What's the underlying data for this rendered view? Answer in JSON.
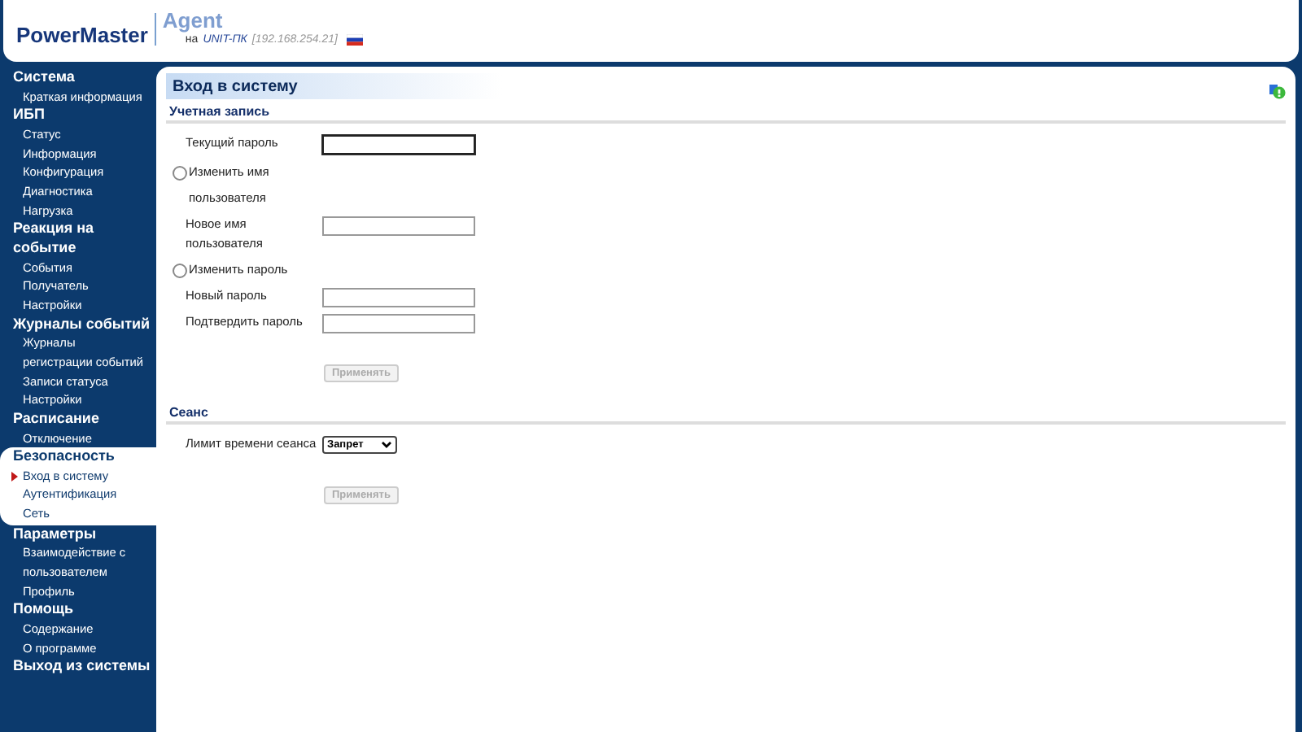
{
  "header": {
    "product": "PowerMaster",
    "app": "Agent",
    "on_label": "на",
    "host": "UNIT-ПК",
    "address": "[192.168.254.21]"
  },
  "sidebar": {
    "groups": [
      {
        "label": "Система",
        "selected": false,
        "children": [
          {
            "label": "Краткая информация",
            "selected": false
          }
        ]
      },
      {
        "label": "ИБП",
        "selected": false,
        "children": [
          {
            "label": "Статус",
            "selected": false
          },
          {
            "label": "Информация",
            "selected": false
          },
          {
            "label": "Конфигурация",
            "selected": false
          },
          {
            "label": "Диагностика",
            "selected": false
          },
          {
            "label": "Нагрузка",
            "selected": false
          }
        ]
      },
      {
        "label": "Реакция на событие",
        "selected": false,
        "children": [
          {
            "label": "События",
            "selected": false
          },
          {
            "label": "Получатель",
            "selected": false
          },
          {
            "label": "Настройки",
            "selected": false
          }
        ]
      },
      {
        "label": "Журналы событий",
        "selected": false,
        "children": [
          {
            "label": "Журналы регистрации событий",
            "selected": false
          },
          {
            "label": "Записи статуса",
            "selected": false
          },
          {
            "label": "Настройки",
            "selected": false
          }
        ]
      },
      {
        "label": "Расписание",
        "selected": false,
        "children": [
          {
            "label": "Отключение",
            "selected": false
          }
        ]
      },
      {
        "label": "Безопасность",
        "selected": true,
        "children": [
          {
            "label": "Вход в систему",
            "selected": true
          },
          {
            "label": "Аутентификация",
            "selected": false
          },
          {
            "label": "Сеть",
            "selected": false
          }
        ]
      },
      {
        "label": "Параметры",
        "selected": false,
        "children": [
          {
            "label": "Взаимодействие с пользователем",
            "selected": false
          },
          {
            "label": "Профиль",
            "selected": false
          }
        ]
      },
      {
        "label": "Помощь",
        "selected": false,
        "children": [
          {
            "label": "Содержание",
            "selected": false
          },
          {
            "label": "О программе",
            "selected": false
          }
        ]
      },
      {
        "label": "Выход из системы",
        "selected": false
      }
    ]
  },
  "page_title": "Вход в систему",
  "sections": [
    {
      "title": "Учетная запись",
      "rows": [
        {
          "kind": "field",
          "label": "Текущий пароль",
          "focused": true
        },
        {
          "kind": "radio",
          "label": "Изменить имя пользователя",
          "checked": false
        },
        {
          "kind": "field",
          "label": "Новое имя пользователя",
          "focused": false
        },
        {
          "kind": "radio",
          "label": "Изменить пароль",
          "checked": false
        },
        {
          "kind": "field",
          "label": "Новый пароль",
          "focused": false
        },
        {
          "kind": "field",
          "label": "Подтвердить пароль",
          "focused": false
        }
      ],
      "button": {
        "label": "Применять",
        "disabled": true
      }
    },
    {
      "title": "Сеанс",
      "rows": [
        {
          "kind": "select",
          "label": "Лимит времени сеанса",
          "value": "Запрет"
        }
      ],
      "button": {
        "label": "Применять",
        "disabled": true
      }
    }
  ]
}
